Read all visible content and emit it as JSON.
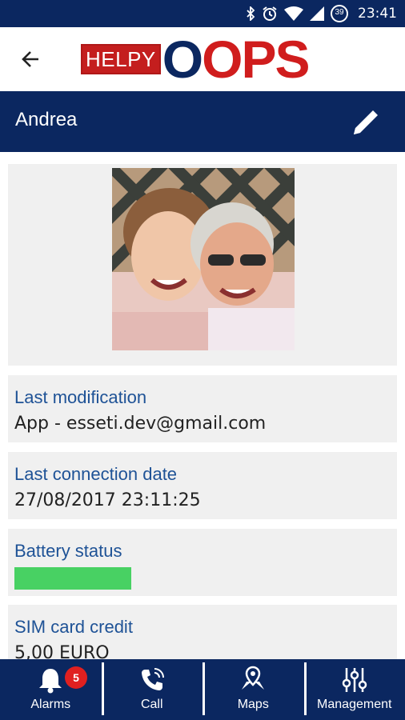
{
  "status_bar": {
    "time": "23:41",
    "icons": [
      "bluetooth-icon",
      "alarm-icon",
      "wifi-icon",
      "signal-icon",
      "battery-icon"
    ],
    "battery_badge": "39"
  },
  "header": {
    "logo_part1": "HELPY",
    "logo_part2_o": "O",
    "logo_part2_rest": "OPS"
  },
  "title_bar": {
    "title": "Andrea"
  },
  "cards": {
    "last_modification": {
      "label": "Last modification",
      "value": "App - esseti.dev@gmail.com"
    },
    "last_connection": {
      "label": "Last connection date",
      "value": "27/08/2017 23:11:25"
    },
    "battery": {
      "label": "Battery status",
      "level": 1.0,
      "color": "#48d163"
    },
    "sim_credit": {
      "label": "SIM card credit",
      "value": "5,00 EURO"
    }
  },
  "bottom_nav": {
    "alarms": {
      "label": "Alarms",
      "badge": "5"
    },
    "call": {
      "label": "Call"
    },
    "maps": {
      "label": "Maps"
    },
    "management": {
      "label": "Management"
    }
  },
  "colors": {
    "primary": "#0b2760",
    "accent_red": "#c41e1e",
    "label_blue": "#1e5296",
    "card_bg": "#f0f0f0"
  }
}
